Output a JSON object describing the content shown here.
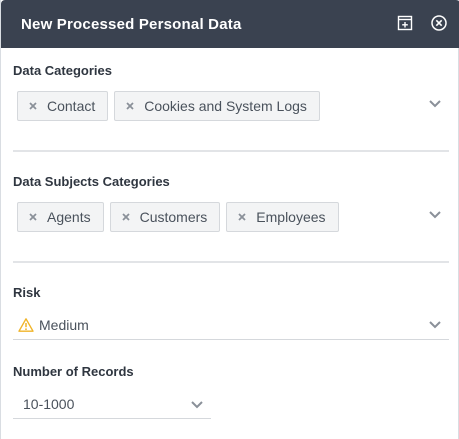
{
  "window": {
    "title": "New Processed Personal Data",
    "icons": [
      "add-panel-icon",
      "close-circle-icon"
    ]
  },
  "colors": {
    "titlebar_bg": "#3a4250",
    "warning": "#f0b429",
    "chip_bg": "#f3f4f5"
  },
  "data_categories": {
    "label": "Data Categories",
    "chips": [
      {
        "label": "Contact"
      },
      {
        "label": "Cookies and System Logs"
      }
    ]
  },
  "data_subjects_categories": {
    "label": "Data Subjects Categories",
    "chips": [
      {
        "label": "Agents"
      },
      {
        "label": "Customers"
      },
      {
        "label": "Employees"
      }
    ]
  },
  "risk": {
    "label": "Risk",
    "value": "Medium",
    "icon": "warning-icon"
  },
  "number_of_records": {
    "label": "Number of Records",
    "value": "10-1000"
  }
}
